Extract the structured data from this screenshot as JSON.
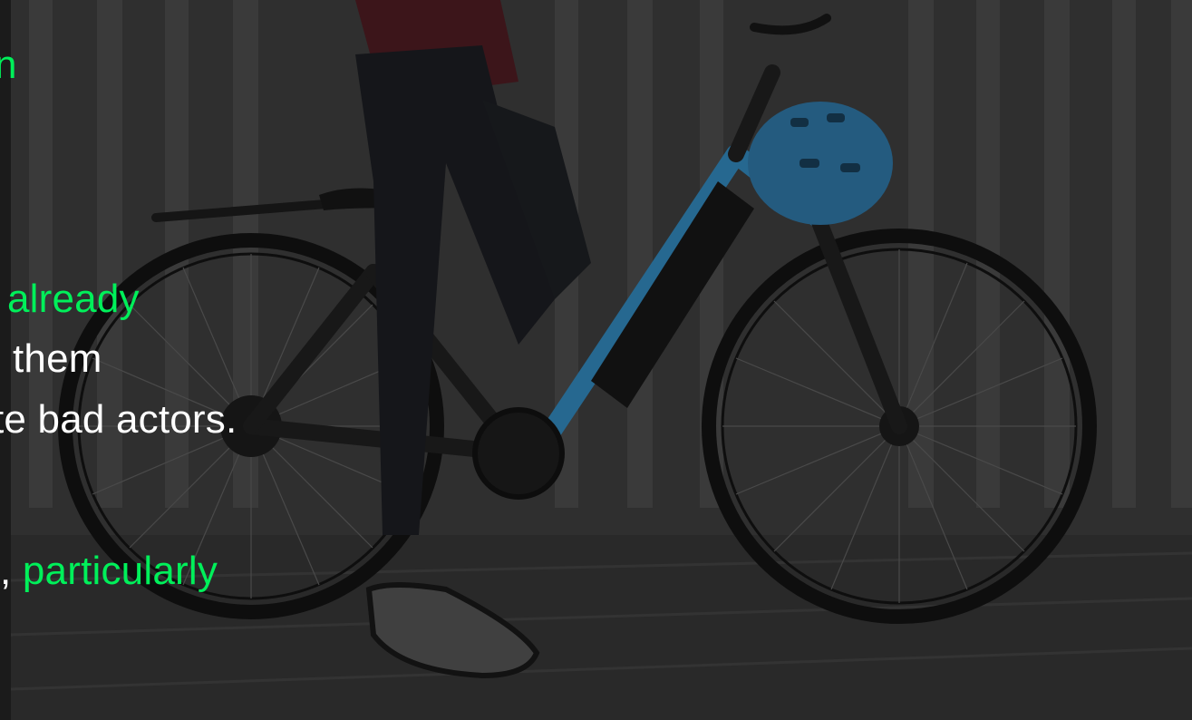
{
  "colors": {
    "accent": "#00f05a",
    "text": "#ffffff",
    "overlay": "#2f2f2f"
  },
  "image": {
    "subject": "e-bike-photo"
  },
  "slide_text": {
    "line1": {
      "text": "n"
    },
    "line2": {
      "text": "already"
    },
    "line3": {
      "text": "them"
    },
    "line4": {
      "text": "te bad actors."
    },
    "line5_prefix": {
      "text": ","
    },
    "line5_highlight": {
      "text": "particularly"
    }
  }
}
